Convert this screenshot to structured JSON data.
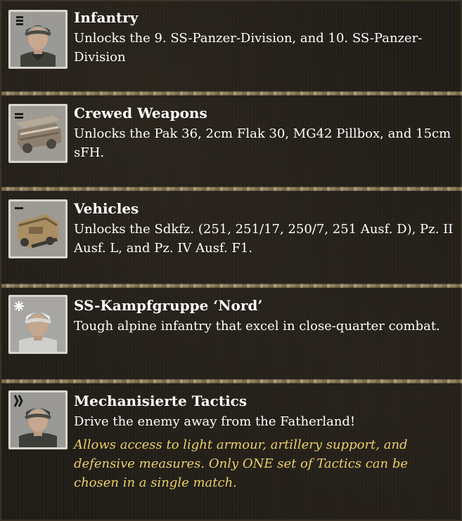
{
  "units": [
    {
      "icon": "infantry-soldier-portrait-icon",
      "title": "Infantry",
      "description": "Unlocks the 9. SS-Panzer-Division, and 10. SS-Panzer-Division"
    },
    {
      "icon": "crewed-weapons-icon",
      "title": "Crewed Weapons",
      "description": "Unlocks the Pak 36, 2cm Flak 30, MG42 Pillbox, and 15cm sFH."
    },
    {
      "icon": "halftrack-vehicle-icon",
      "title": "Vehicles",
      "description": "Unlocks the Sdkfz. (251, 251/17, 250/7, 251 Ausf. D), Pz. II Ausf. L, and Pz. IV Ausf. F1."
    },
    {
      "icon": "alpine-soldier-portrait-icon",
      "title": "SS-Kampfgruppe ‘Nord’",
      "description": "Tough alpine infantry that excel in close-quarter combat."
    },
    {
      "icon": "mechanized-tactics-soldier-icon",
      "title": "Mechanisierte Tactics",
      "description": "Drive the enemy away from the Fatherland!",
      "note": "Allows access to light armour, artillery support, and defensive measures. Only ONE set of Tactics can be chosen in a single match."
    }
  ],
  "colors": {
    "title": "#ffffff",
    "description": "#ffffff",
    "note": "#e8cf6a",
    "background": "#211d17",
    "divider": "#c9b68a"
  }
}
